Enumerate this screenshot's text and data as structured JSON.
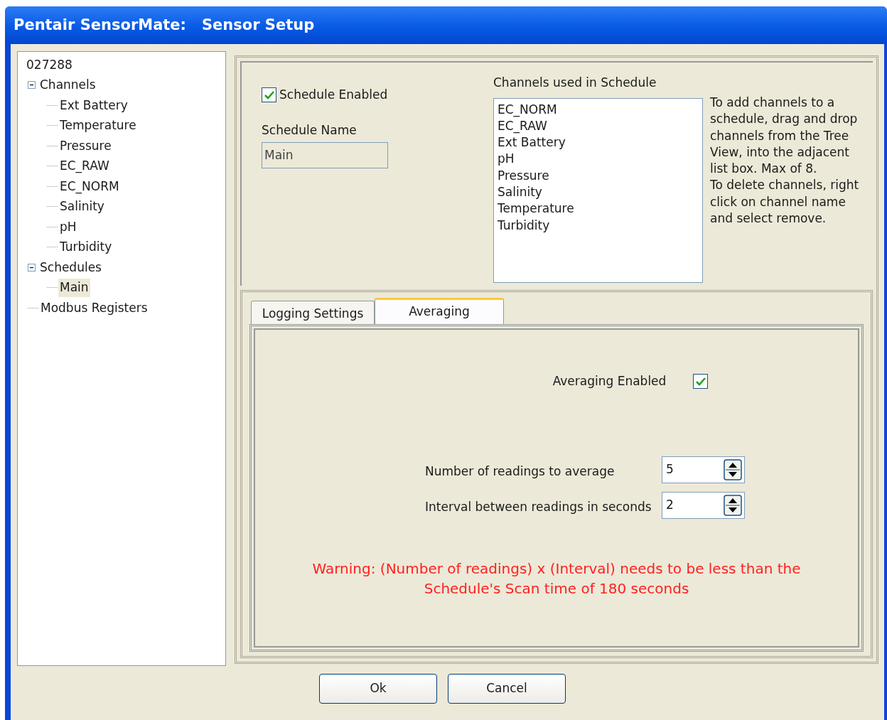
{
  "window": {
    "title": "Pentair SensorMate:   Sensor Setup"
  },
  "tree": {
    "items": [
      {
        "label": "027288",
        "selected": false,
        "children": [
          {
            "label": "Channels",
            "expanded": true,
            "selected": false,
            "children": [
              {
                "label": "Ext Battery",
                "selected": false
              },
              {
                "label": "Temperature",
                "selected": false
              },
              {
                "label": "Pressure",
                "selected": false
              },
              {
                "label": "EC_RAW",
                "selected": false
              },
              {
                "label": "EC_NORM",
                "selected": false
              },
              {
                "label": "Salinity",
                "selected": false
              },
              {
                "label": "pH",
                "selected": false
              },
              {
                "label": "Turbidity",
                "selected": false
              }
            ]
          },
          {
            "label": "Schedules",
            "expanded": true,
            "selected": false,
            "children": [
              {
                "label": "Main",
                "selected": true
              }
            ]
          },
          {
            "label": "Modbus Registers",
            "selected": false
          }
        ]
      }
    ]
  },
  "schedule": {
    "enabled_label": "Schedule Enabled",
    "enabled": true,
    "name_label": "Schedule Name",
    "name_value": "Main"
  },
  "channels_list": {
    "label": "Channels used in Schedule",
    "items": [
      "EC_NORM",
      "EC_RAW",
      "Ext Battery",
      "pH",
      "Pressure",
      "Salinity",
      "Temperature",
      "Turbidity"
    ],
    "help": [
      "To add channels to a schedule, drag and drop channels from the Tree View, into the adjacent list box. Max of 8.",
      "To delete channels, right click on channel name and select remove."
    ]
  },
  "tabs": [
    {
      "label": "Logging Settings",
      "selected": false
    },
    {
      "label": "Averaging",
      "selected": true
    }
  ],
  "averaging": {
    "enabled_label": "Averaging Enabled",
    "enabled": true,
    "fields": [
      {
        "label": "Number of readings to average",
        "value": "5"
      },
      {
        "label": "Interval between readings in seconds",
        "value": "2"
      }
    ],
    "warning": [
      "Warning: (Number of readings) x (Interval) needs to be less than the",
      "Schedule's Scan time of 180 seconds"
    ]
  },
  "buttons": [
    "Ok",
    "Cancel"
  ]
}
